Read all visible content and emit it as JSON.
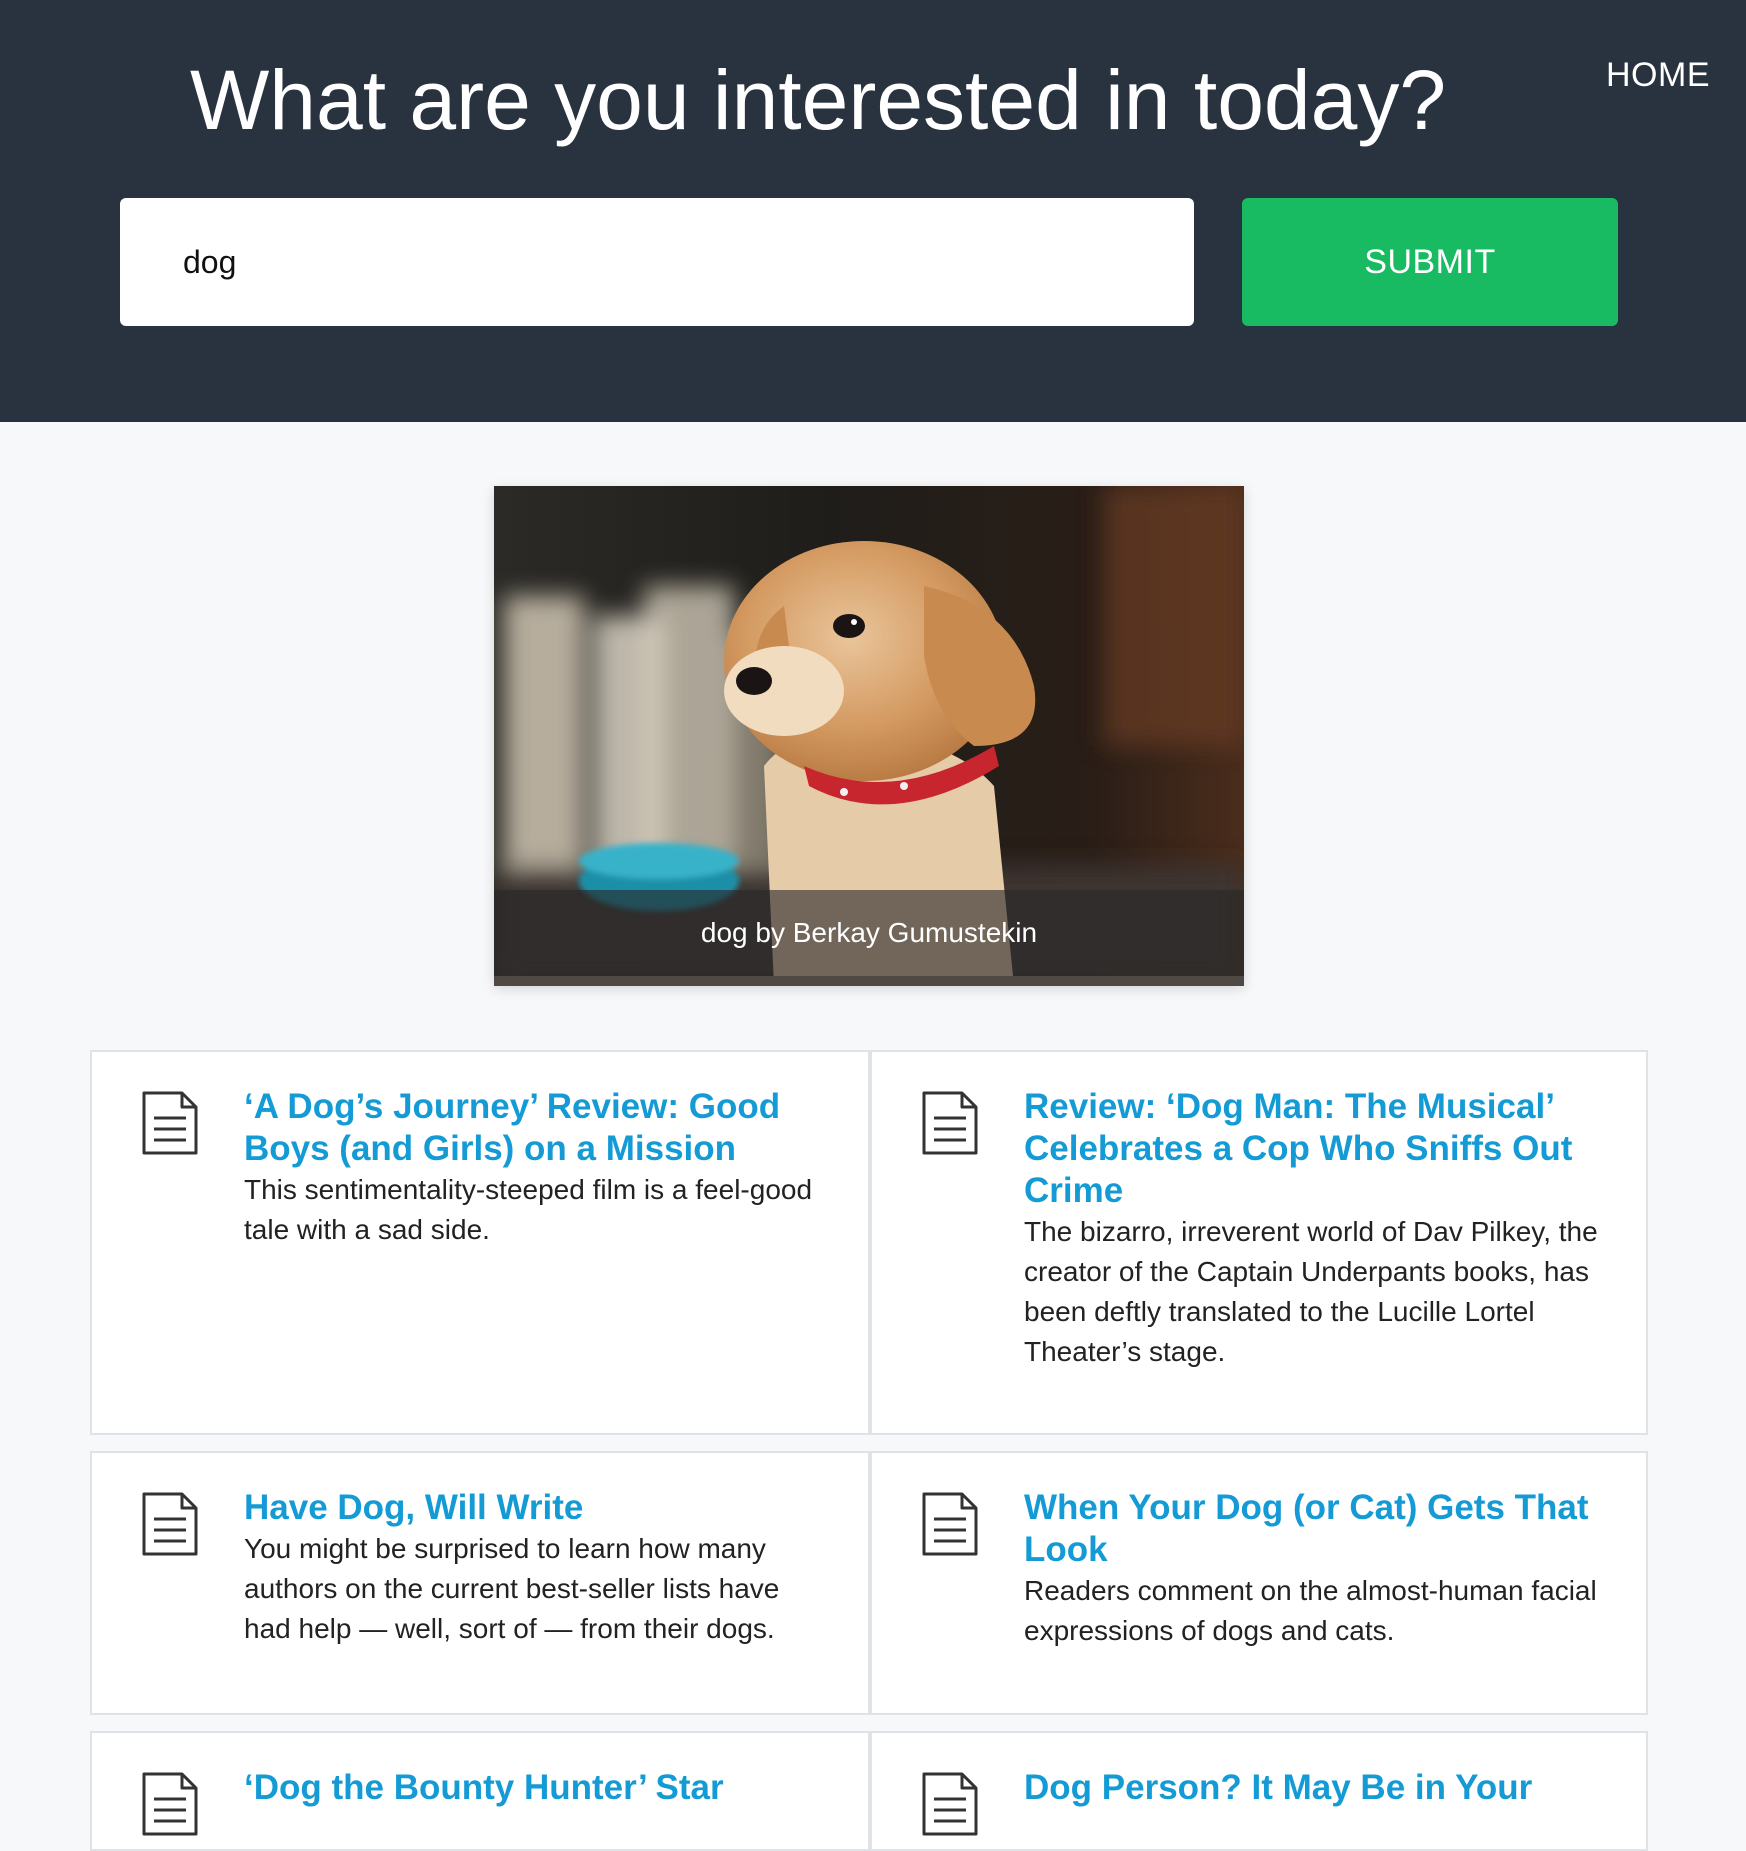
{
  "nav": {
    "home_label": "HOME"
  },
  "header": {
    "headline": "What are you interested in today?"
  },
  "search": {
    "value": "dog",
    "submit_label": "SUBMIT"
  },
  "hero": {
    "caption": "dog by Berkay Gumustekin"
  },
  "articles": [
    {
      "title": "‘A Dog’s Journey’ Review: Good Boys (and Girls) on a Mission",
      "description": "This sentimentality-steeped film is a feel-good tale with a sad side."
    },
    {
      "title": "Review: ‘Dog Man: The Musical’ Celebrates a Cop Who Sniffs Out Crime",
      "description": "The bizarro, irreverent world of Dav Pilkey, the creator of the Captain Underpants books, has been deftly translated to the Lucille Lortel Theater’s stage."
    },
    {
      "title": "Have Dog, Will Write",
      "description": "You might be surprised to learn how many authors on the current best-seller lists have had help — well, sort of — from their dogs."
    },
    {
      "title": "When Your Dog (or Cat) Gets That Look",
      "description": "Readers comment on the almost-human facial expressions of dogs and cats."
    },
    {
      "title": "‘Dog the Bounty Hunter’ Star",
      "description": ""
    },
    {
      "title": "Dog Person? It May Be in Your",
      "description": ""
    }
  ],
  "colors": {
    "header_bg": "#29333f",
    "submit_bg": "#19bb62",
    "link": "#149bd5",
    "page_bg": "#f7f8fa"
  },
  "icons": {
    "article": "document-icon"
  }
}
